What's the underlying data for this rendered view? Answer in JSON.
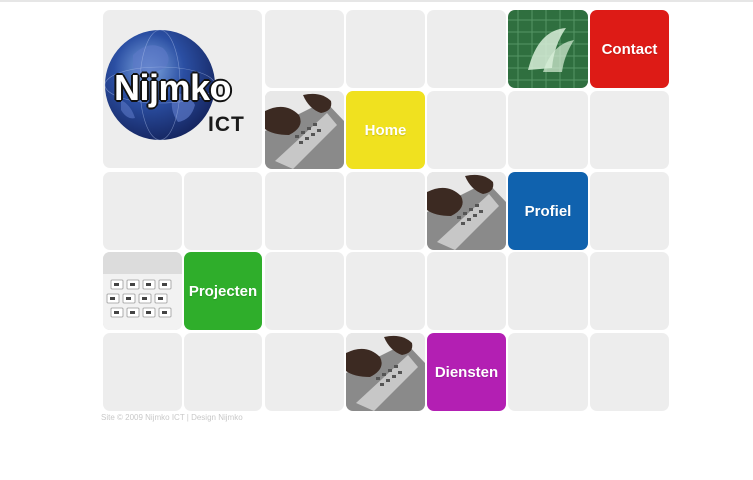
{
  "brand": {
    "name": "Nijmko",
    "suffix": "ICT"
  },
  "nav": {
    "contact": "Contact",
    "home": "Home",
    "profiel": "Profiel",
    "projecten": "Projecten",
    "diensten": "Diensten"
  },
  "colors": {
    "contact": "#dd1b16",
    "home": "#f0e11f",
    "profiel": "#1062ae",
    "projecten": "#2fae2b",
    "diensten": "#b31fb3",
    "tile": "#ededed"
  },
  "images": {
    "logo": "globe-logo-icon",
    "laptop": "laptop-typing-photo",
    "decor": "green-circuit-photo",
    "keyboard": "keyboard-keys-photo"
  },
  "footer": {
    "text": "Site © 2009 Nijmko ICT | Design Nijmko"
  }
}
